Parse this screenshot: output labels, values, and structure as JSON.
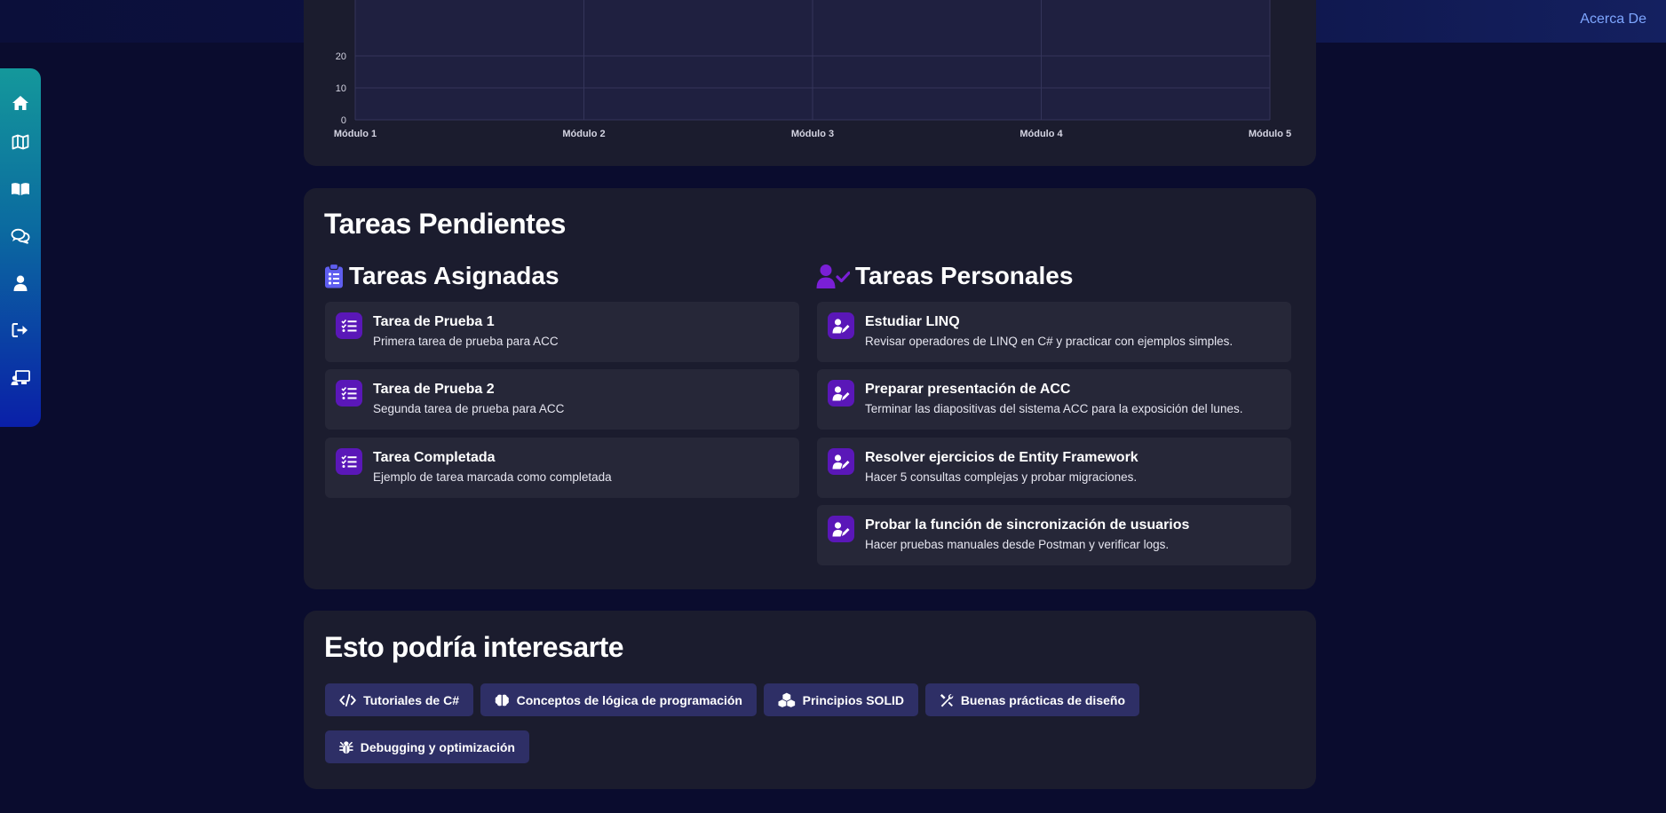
{
  "header": {
    "about_label": "Acerca De"
  },
  "sidebar": {
    "items": [
      {
        "icon": "home-icon"
      },
      {
        "icon": "map-icon"
      },
      {
        "icon": "book-open-icon"
      },
      {
        "icon": "comments-icon"
      },
      {
        "icon": "user-icon"
      },
      {
        "icon": "sign-out-icon"
      },
      {
        "icon": "chalkboard-user-icon"
      }
    ]
  },
  "chart_data": {
    "type": "line",
    "categories": [
      "Módulo 1",
      "Módulo 2",
      "Módulo 3",
      "Módulo 4",
      "Módulo 5"
    ],
    "y_ticks": [
      "0",
      "10",
      "20"
    ],
    "series": []
  },
  "tasks": {
    "title": "Tareas Pendientes",
    "assigned": {
      "title": "Tareas Asignadas",
      "items": [
        {
          "title": "Tarea de Prueba 1",
          "desc": "Primera tarea de prueba para ACC"
        },
        {
          "title": "Tarea de Prueba 2",
          "desc": "Segunda tarea de prueba para ACC"
        },
        {
          "title": "Tarea Completada",
          "desc": "Ejemplo de tarea marcada como completada"
        }
      ]
    },
    "personal": {
      "title": "Tareas Personales",
      "items": [
        {
          "title": "Estudiar LINQ",
          "desc": "Revisar operadores de LINQ en C# y practicar con ejemplos simples."
        },
        {
          "title": "Preparar presentación de ACC",
          "desc": "Terminar las diapositivas del sistema ACC para la exposición del lunes."
        },
        {
          "title": "Resolver ejercicios de Entity Framework",
          "desc": "Hacer 5 consultas complejas y probar migraciones."
        },
        {
          "title": "Probar la función de sincronización de usuarios",
          "desc": "Hacer pruebas manuales desde Postman y verificar logs."
        }
      ]
    }
  },
  "interest": {
    "title": "Esto podría interesarte",
    "chips": [
      {
        "label": "Tutoriales de C#",
        "icon": "code-icon"
      },
      {
        "label": "Conceptos de lógica de programación",
        "icon": "brain-icon"
      },
      {
        "label": "Principios SOLID",
        "icon": "cubes-icon"
      },
      {
        "label": "Buenas prácticas de diseño",
        "icon": "tools-icon"
      },
      {
        "label": "Debugging y optimización",
        "icon": "bug-icon"
      }
    ]
  }
}
